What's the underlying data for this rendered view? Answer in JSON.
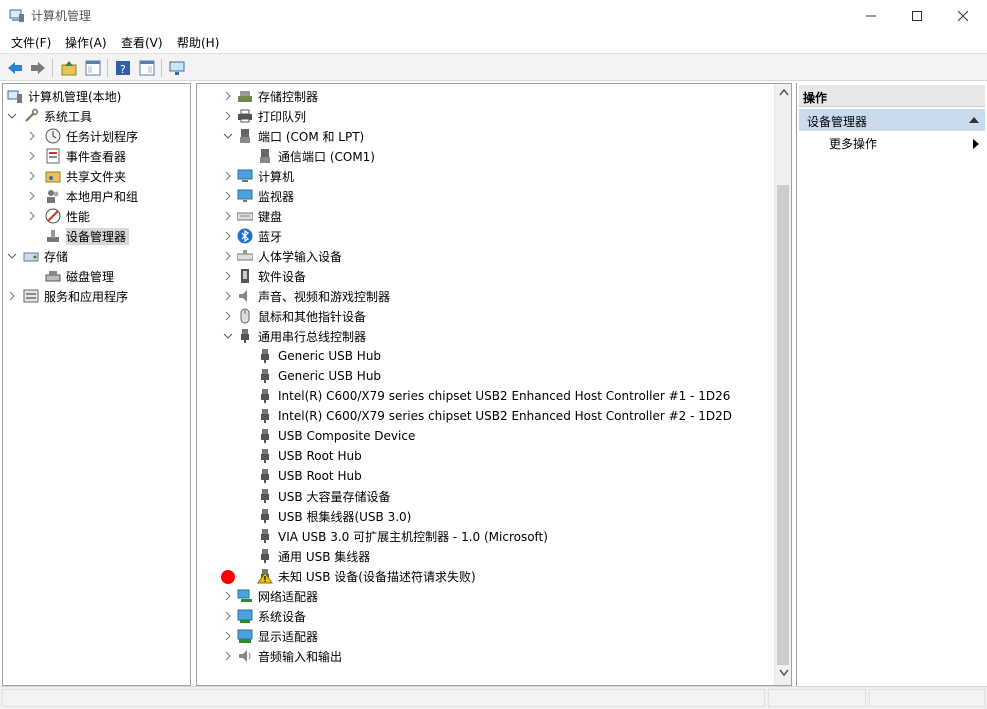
{
  "window": {
    "title": "计算机管理",
    "icon": "computer-management-icon"
  },
  "menu": [
    {
      "label": "文件(F)"
    },
    {
      "label": "操作(A)"
    },
    {
      "label": "查看(V)"
    },
    {
      "label": "帮助(H)"
    }
  ],
  "toolbar": {
    "buttons": [
      "back-icon",
      "forward-icon",
      "up-folder-icon",
      "show-hide-tree-icon",
      "help-icon",
      "show-action-pane-icon",
      "monitor-icon"
    ]
  },
  "left_tree": {
    "root": "计算机管理(本地)",
    "items": [
      {
        "label": "系统工具",
        "icon": "tools-icon"
      },
      {
        "label": "任务计划程序",
        "icon": "clock-icon"
      },
      {
        "label": "事件查看器",
        "icon": "event-viewer-icon"
      },
      {
        "label": "共享文件夹",
        "icon": "shared-folder-icon"
      },
      {
        "label": "本地用户和组",
        "icon": "users-icon"
      },
      {
        "label": "性能",
        "icon": "performance-icon"
      },
      {
        "label": "设备管理器",
        "icon": "device-manager-icon"
      },
      {
        "label": "存储",
        "icon": "storage-icon"
      },
      {
        "label": "磁盘管理",
        "icon": "disk-icon"
      },
      {
        "label": "服务和应用程序",
        "icon": "services-icon"
      }
    ]
  },
  "device_tree": {
    "items": [
      {
        "label": "存储控制器",
        "icon": "storage-controller-icon"
      },
      {
        "label": "打印队列",
        "icon": "printer-icon"
      },
      {
        "label": "端口 (COM 和 LPT)",
        "icon": "port-icon"
      },
      {
        "label": "通信端口 (COM1)",
        "icon": "port-icon"
      },
      {
        "label": "计算机",
        "icon": "computer-icon"
      },
      {
        "label": "监视器",
        "icon": "monitor-icon"
      },
      {
        "label": "键盘",
        "icon": "keyboard-icon"
      },
      {
        "label": "蓝牙",
        "icon": "bluetooth-icon"
      },
      {
        "label": "人体学输入设备",
        "icon": "hid-icon"
      },
      {
        "label": "软件设备",
        "icon": "software-device-icon"
      },
      {
        "label": "声音、视频和游戏控制器",
        "icon": "speaker-icon"
      },
      {
        "label": "鼠标和其他指针设备",
        "icon": "mouse-icon"
      },
      {
        "label": "通用串行总线控制器",
        "icon": "usb-icon"
      },
      {
        "label": "Generic USB Hub",
        "icon": "usb-icon"
      },
      {
        "label": "Generic USB Hub",
        "icon": "usb-icon"
      },
      {
        "label": "Intel(R) C600/X79 series chipset USB2 Enhanced Host Controller #1 - 1D26",
        "icon": "usb-icon"
      },
      {
        "label": "Intel(R) C600/X79 series chipset USB2 Enhanced Host Controller #2 - 1D2D",
        "icon": "usb-icon"
      },
      {
        "label": "USB Composite Device",
        "icon": "usb-icon"
      },
      {
        "label": "USB Root Hub",
        "icon": "usb-icon"
      },
      {
        "label": "USB Root Hub",
        "icon": "usb-icon"
      },
      {
        "label": "USB 大容量存储设备",
        "icon": "usb-icon"
      },
      {
        "label": "USB 根集线器(USB 3.0)",
        "icon": "usb-icon"
      },
      {
        "label": "VIA USB 3.0 可扩展主机控制器 - 1.0 (Microsoft)",
        "icon": "usb-icon"
      },
      {
        "label": "通用 USB 集线器",
        "icon": "usb-icon"
      },
      {
        "label": "未知 USB 设备(设备描述符请求失败)",
        "icon": "warning-icon"
      },
      {
        "label": "网络适配器",
        "icon": "network-adapter-icon"
      },
      {
        "label": "系统设备",
        "icon": "system-device-icon"
      },
      {
        "label": "显示适配器",
        "icon": "display-adapter-icon"
      },
      {
        "label": "音频输入和输出",
        "icon": "audio-icon"
      }
    ]
  },
  "actions": {
    "header": "操作",
    "group": "设备管理器",
    "more": "更多操作"
  },
  "colors": {
    "selection": "#d9d9d9",
    "action_group": "#c9dbec",
    "marker": "#ff0000"
  }
}
